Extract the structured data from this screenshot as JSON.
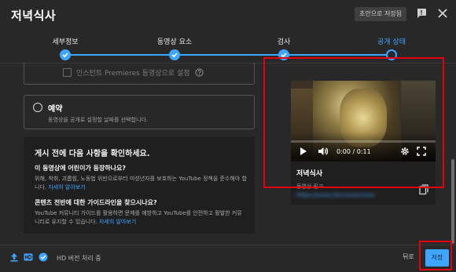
{
  "dialog": {
    "title": "저녁식사",
    "draft_badge": "초안으로 저장됨"
  },
  "stepper": {
    "steps": [
      {
        "label": "세부정보"
      },
      {
        "label": "동영상 요소"
      },
      {
        "label": "검사"
      },
      {
        "label": "공개 상태"
      }
    ]
  },
  "visibility": {
    "premiere_label": "인스턴트 Premieres 동영상으로 설정",
    "schedule_title": "예약",
    "schedule_desc": "동영상을 공개로 설정할 날짜를 선택합니다."
  },
  "checklist": {
    "title": "게시 전에 다음 사항을 확인하세요.",
    "q1_title": "이 동영상에 어린이가 등장하나요?",
    "q1_desc": "위해, 착취, 괴롭힘, 노동법 위반으로부터 미성년자를 보호하는 YouTube 정책을 준수해야 합니다.",
    "q1_link": "자세히 알아보기",
    "q2_title": "콘텐츠 전반에 대한 가이드라인을 찾으시나요?",
    "q2_desc": "YouTube 커뮤니티 가이드를 활용하면 문제를 예방하고 YouTube를 안전하고 활발한 커뮤니티로 유지할 수 있습니다.",
    "q2_link": "자세히 알아보기"
  },
  "video": {
    "time": "0:00 / 0:11",
    "title": "저녁식사",
    "link_label": "동영상 링크",
    "link": "https://youtu.be/xxxxxxxxxx"
  },
  "footer": {
    "status": "HD 버전 처리 중",
    "back_label": "뒤로",
    "save_label": "저장"
  },
  "colors": {
    "accent": "#3ea6ff",
    "highlight": "#e3000f"
  }
}
